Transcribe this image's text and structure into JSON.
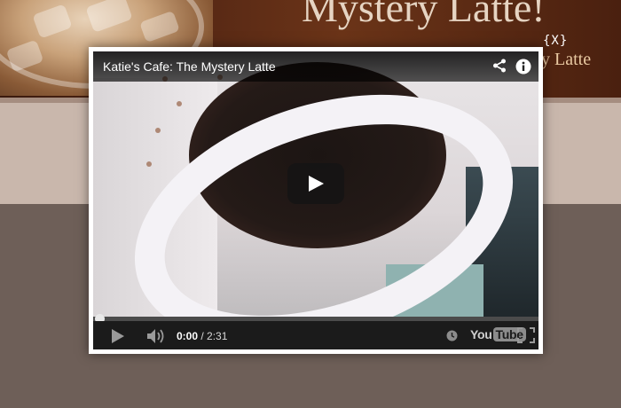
{
  "page": {
    "banner_title": "Mystery Latte!",
    "banner_subtitle": "y Latte"
  },
  "lightbox": {
    "close_label": "{X}"
  },
  "video": {
    "title": "Katie's Cafe: The Mystery Latte",
    "current_time": "0:00",
    "duration": " / 2:31",
    "brand_left": "You",
    "brand_right": "Tube",
    "progress_fraction": 0.0,
    "icons": [
      "share-icon",
      "info-icon",
      "play-icon",
      "volume-icon",
      "clock-icon",
      "fullscreen-icon"
    ]
  },
  "colors": {
    "banner_brown": "#5a2a15",
    "light_stripe": "#c9b7ac",
    "dark_background": "#6e5f58",
    "progress_played": "#cc0000"
  }
}
